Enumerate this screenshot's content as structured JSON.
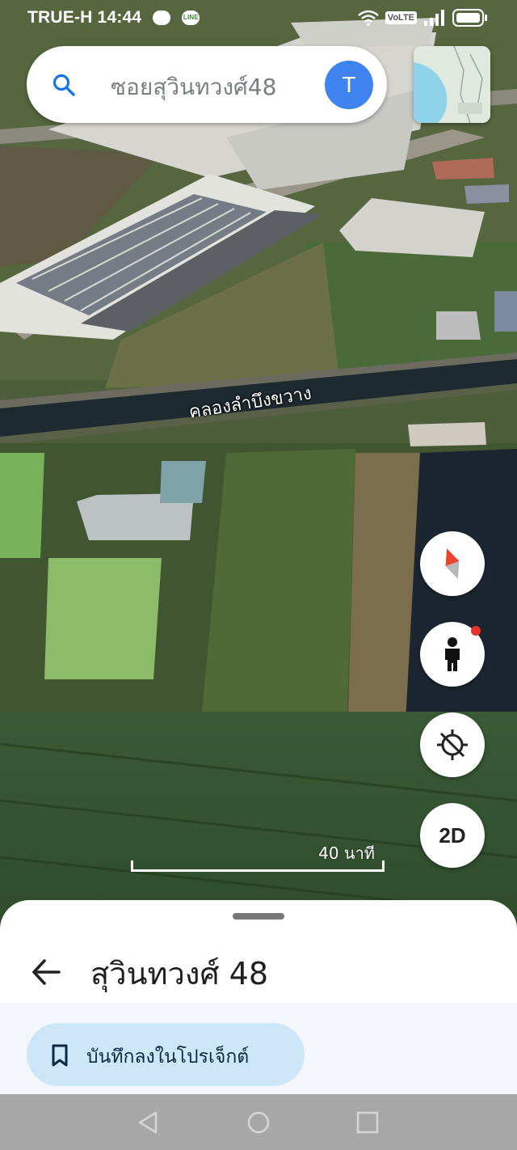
{
  "status_bar": {
    "carrier_time": "TRUE-H 14:44",
    "line_badge": "LINE",
    "volte": "VoLTE"
  },
  "search": {
    "placeholder": "ซอยสุวินทวงศ์48",
    "avatar_letter": "T"
  },
  "map": {
    "canal_label": "คลองลำบึงขวาง",
    "scale_label": "40 นาที",
    "view_mode_button": "2D",
    "icons": [
      "search-icon",
      "layers-thumbnail",
      "compass-icon",
      "street-view-icon",
      "location-icon",
      "2d-toggle"
    ],
    "colors": {
      "water": "#1b2630",
      "field": "#8cbc6a",
      "roof": "#d8d8d2"
    }
  },
  "bottom_sheet": {
    "title": "สุวินทวงศ์ 48",
    "save_label": "บันทึกลงในโปรเจ็กต์"
  },
  "colors": {
    "accent": "#3f83f0",
    "chip": "#cde6f8",
    "notify_dot": "#e8332b"
  }
}
